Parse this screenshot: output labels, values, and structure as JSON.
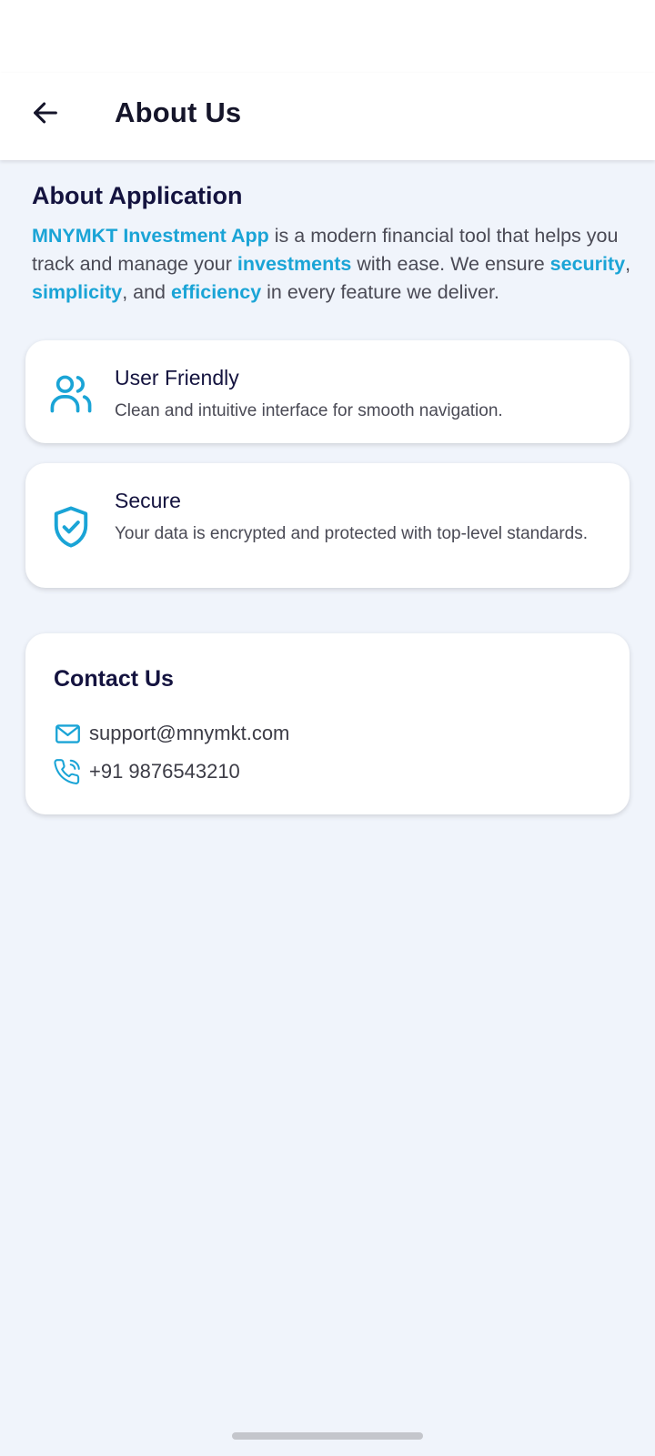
{
  "header": {
    "back_icon": "arrow-left-icon",
    "title": "About Us"
  },
  "about": {
    "heading": "About Application",
    "paragraph": [
      {
        "text": "MNYMKT Investment App",
        "highlight": true
      },
      {
        "text": " is a modern financial tool that helps you track and manage your ",
        "highlight": false
      },
      {
        "text": "investments",
        "highlight": true
      },
      {
        "text": " with ease. We ensure ",
        "highlight": false
      },
      {
        "text": "security",
        "highlight": true
      },
      {
        "text": ", ",
        "highlight": false
      },
      {
        "text": "simplicity",
        "highlight": true
      },
      {
        "text": ", and ",
        "highlight": false
      },
      {
        "text": "efficiency",
        "highlight": true
      },
      {
        "text": " in every feature we deliver.",
        "highlight": false
      }
    ]
  },
  "features": [
    {
      "icon": "users-icon",
      "title": "User Friendly",
      "description": "Clean and intuitive interface for smooth navigation."
    },
    {
      "icon": "shield-check-icon",
      "title": "Secure",
      "description": "Your data is encrypted and protected with top-level standards."
    }
  ],
  "contact": {
    "title": "Contact Us",
    "email_icon": "mail-icon",
    "email": "support@mnymkt.com",
    "phone_icon": "phone-icon",
    "phone": "+91 9876543210"
  },
  "colors": {
    "accent": "#1aa4d6",
    "heading": "#14133f",
    "background": "#f0f4fb",
    "card": "#ffffff"
  }
}
